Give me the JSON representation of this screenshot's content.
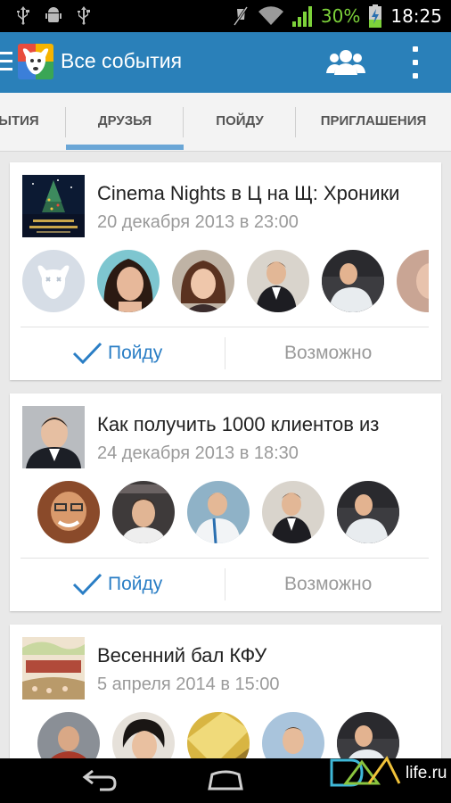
{
  "status_bar": {
    "battery_percent": "30%",
    "time": "18:25"
  },
  "app_bar": {
    "title": "Все события",
    "icons": [
      "menu-icon",
      "vk-logo",
      "friends-icon",
      "overflow-icon"
    ]
  },
  "tabs": [
    {
      "label": "ЫТИЯ"
    },
    {
      "label": "ДРУЗЬЯ",
      "selected": true
    },
    {
      "label": "ПОЙДУ"
    },
    {
      "label": "ПРИГЛАШЕНИЯ"
    }
  ],
  "events": [
    {
      "title": "Cinema Nights в Ц на Щ: Хроники",
      "date": "20 декабря 2013 в 23:00",
      "go_label": "Пойду",
      "maybe_label": "Возможно"
    },
    {
      "title": "Как получить 1000 клиентов из",
      "date": "24 декабря 2013 в 18:30",
      "go_label": "Пойду",
      "maybe_label": "Возможно"
    },
    {
      "title": "Весенний бал КФУ",
      "date": "5 апреля 2014 в 15:00"
    }
  ],
  "watermark": {
    "text": "life.ru"
  },
  "colors": {
    "app_bar": "#2a80b9",
    "accent": "#2a7ec5",
    "battery": "#7dd23a",
    "tab_underline": "#6aa6d6"
  }
}
